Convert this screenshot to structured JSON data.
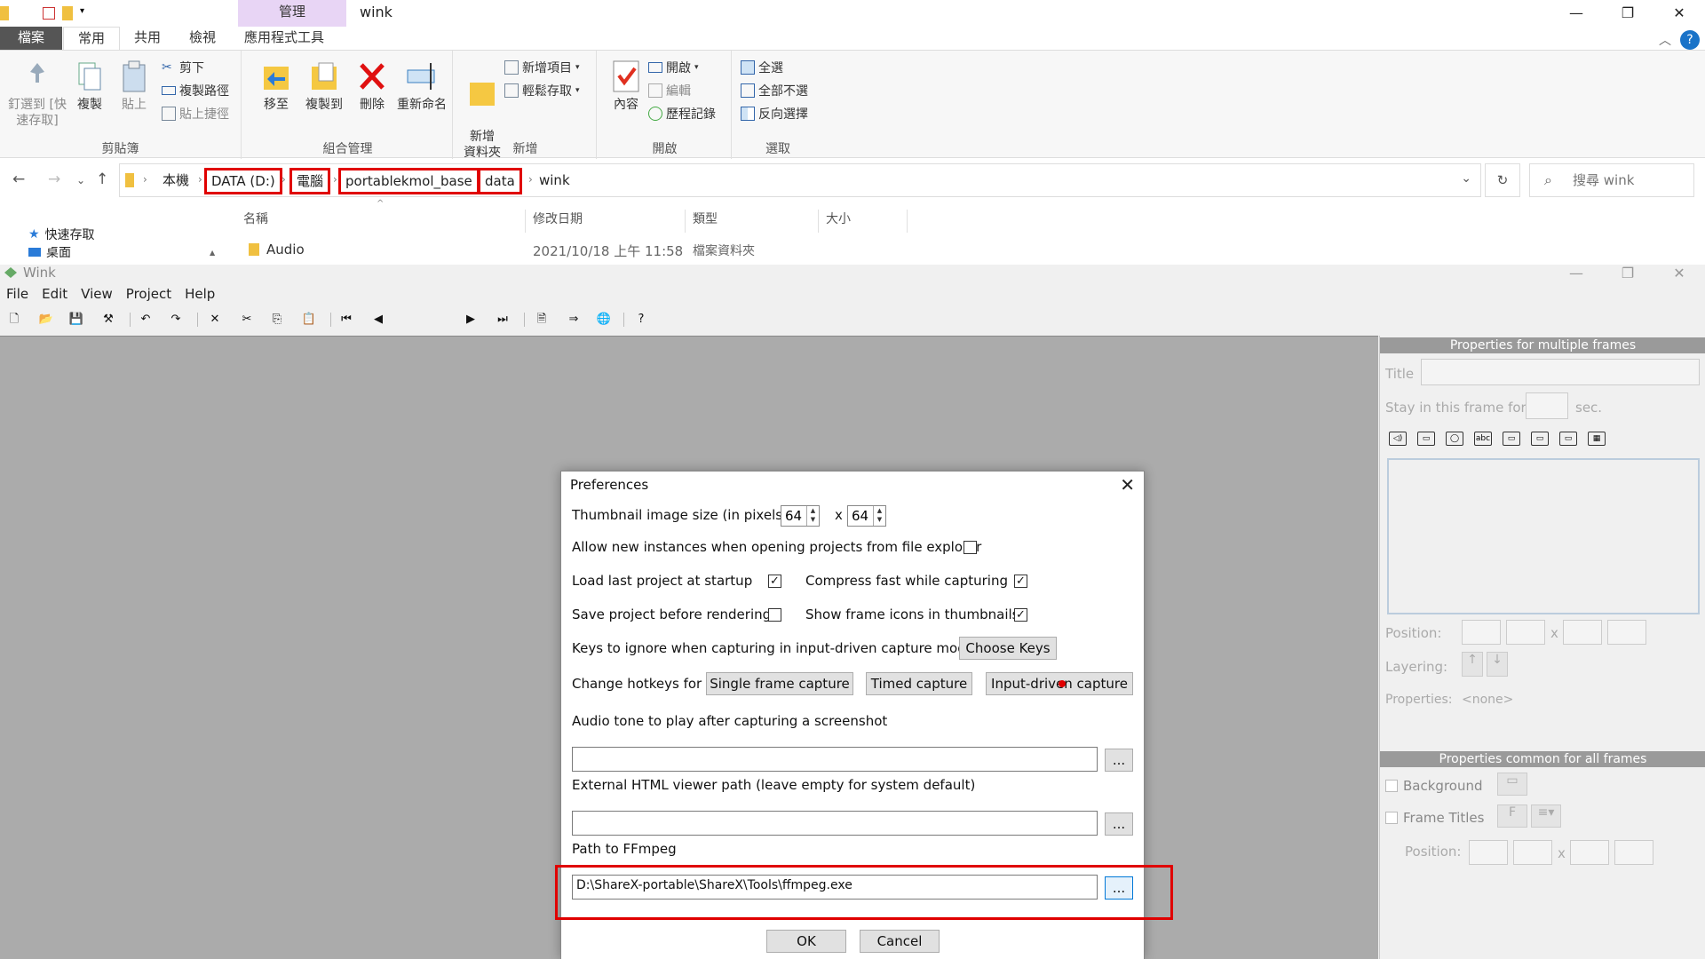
{
  "explorer": {
    "context_tab": "管理",
    "title": "wink",
    "tabs": [
      "檔案",
      "常用",
      "共用",
      "檢視",
      "應用程式工具"
    ],
    "ribbon": {
      "clipboard": {
        "label": "剪貼簿",
        "pin": "釘選到 [快速存取]",
        "copy": "複製",
        "paste": "貼上",
        "cut": "剪下",
        "copy_path": "複製路徑",
        "paste_shortcut": "貼上捷徑"
      },
      "organize": {
        "label": "組合管理",
        "move_to": "移至",
        "copy_to": "複製到",
        "delete": "刪除",
        "rename": "重新命名"
      },
      "new": {
        "label": "新增",
        "new_folder": "新增\n資料夾",
        "new_item": "新增項目",
        "easy_access": "輕鬆存取"
      },
      "open": {
        "label": "開啟",
        "properties": "內容",
        "open": "開啟",
        "edit": "編輯",
        "history": "歷程記錄"
      },
      "select": {
        "label": "選取",
        "select_all": "全選",
        "select_none": "全部不選",
        "invert": "反向選擇"
      }
    },
    "breadcrumbs": [
      "本機",
      "DATA (D:)",
      "電腦",
      "portablekmol_base",
      "data",
      "wink"
    ],
    "search_placeholder": "搜尋 wink",
    "nav_pane": [
      "快速存取",
      "桌面"
    ],
    "columns": [
      "名稱",
      "修改日期",
      "類型",
      "大小"
    ],
    "files": [
      {
        "name": "Audio",
        "modified": "2021/10/18 上午 11:58",
        "type": "檔案資料夾",
        "size": ""
      }
    ]
  },
  "wink": {
    "title": "Wink",
    "menu": [
      "File",
      "Edit",
      "View",
      "Project",
      "Help"
    ],
    "right_panel": {
      "header_multi": "Properties for multiple frames",
      "title_label": "Title",
      "stay_label": "Stay in this frame for",
      "sec_label": "sec.",
      "position_label": "Position:",
      "layering_label": "Layering:",
      "properties_label": "Properties:",
      "properties_value": "<none>",
      "header_common": "Properties common for all frames",
      "background_label": "Background",
      "frame_titles_label": "Frame Titles",
      "position2_label": "Position:",
      "x_sep": "x"
    }
  },
  "preferences": {
    "title": "Preferences",
    "thumb_label": "Thumbnail image size (in pixels)",
    "thumb_w": "64",
    "thumb_h": "64",
    "thumb_x": "x",
    "allow_instances": "Allow new instances when opening projects from file explorer",
    "allow_instances_checked": false,
    "load_last": "Load last project at startup",
    "load_last_checked": true,
    "compress_fast": "Compress fast while capturing",
    "compress_fast_checked": true,
    "save_before": "Save project before rendering",
    "save_before_checked": false,
    "show_icons": "Show frame icons in thumbnails",
    "show_icons_checked": true,
    "keys_ignore": "Keys to ignore when capturing in input-driven capture mode",
    "choose_keys": "Choose Keys",
    "change_hotkeys": "Change hotkeys for",
    "single_frame": "Single frame capture",
    "timed": "Timed capture",
    "input_driven": "Input-driven capture",
    "audio_tone_label": "Audio tone to play after capturing a screenshot",
    "audio_tone_value": "",
    "html_viewer_label": "External HTML viewer path (leave empty for system default)",
    "html_viewer_value": "",
    "ffmpeg_label": "Path to FFmpeg",
    "ffmpeg_value": "D:\\ShareX-portable\\ShareX\\Tools\\ffmpeg.exe",
    "browse": "...",
    "ok": "OK",
    "cancel": "Cancel"
  },
  "colors": {
    "highlight": "#e00000",
    "canvas": "#ababab",
    "panel_header": "#9a9a9a",
    "context_tab": "#e8d5f5"
  }
}
